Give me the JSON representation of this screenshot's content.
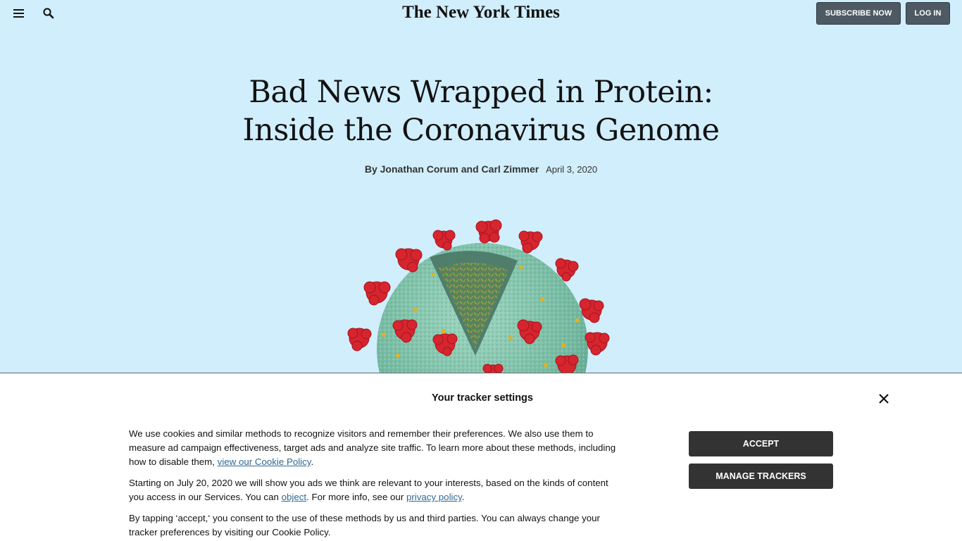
{
  "header": {
    "logo": "The New York Times",
    "menu_icon": "hamburger-menu-icon",
    "search_icon": "search-icon",
    "subscribe_label": "SUBSCRIBE NOW",
    "login_label": "LOG IN"
  },
  "article": {
    "headline_line1": "Bad News Wrapped in Protein:",
    "headline_line2": "Inside the Coronavirus Genome",
    "byline_prefix": "By",
    "author1": "Jonathan Corum",
    "byline_and": "and",
    "author2": "Carl Zimmer",
    "date": "April 3, 2020",
    "illustration_icon": "coronavirus-illustration"
  },
  "consent": {
    "title": "Your tracker settings",
    "close_icon": "close-icon",
    "p1_text": "We use cookies and similar methods to recognize visitors and remember their preferences. We also use them to measure ad campaign effectiveness, target ads and analyze site traffic. To learn more about these methods, including how to disable them,",
    "p1_link": "view our Cookie Policy",
    "p1_end": ".",
    "p2_text": "Starting on July 20, 2020 we will show you ads we think are relevant to your interests, based on the kinds of content you access in our Services. You can",
    "p2_link1": "object",
    "p2_mid": ". For more info, see our",
    "p2_link2": "privacy policy",
    "p2_end": ".",
    "p3_text": "By tapping ‘accept,‘ you consent to the use of these methods by us and third parties. You can always change your tracker preferences by visiting our Cookie Policy.",
    "accept_label": "ACCEPT",
    "manage_label": "MANAGE TRACKERS"
  },
  "colors": {
    "page_background": "#d1eefc",
    "header_button": "#4e5a63",
    "consent_button": "#333333",
    "link": "#326891"
  }
}
